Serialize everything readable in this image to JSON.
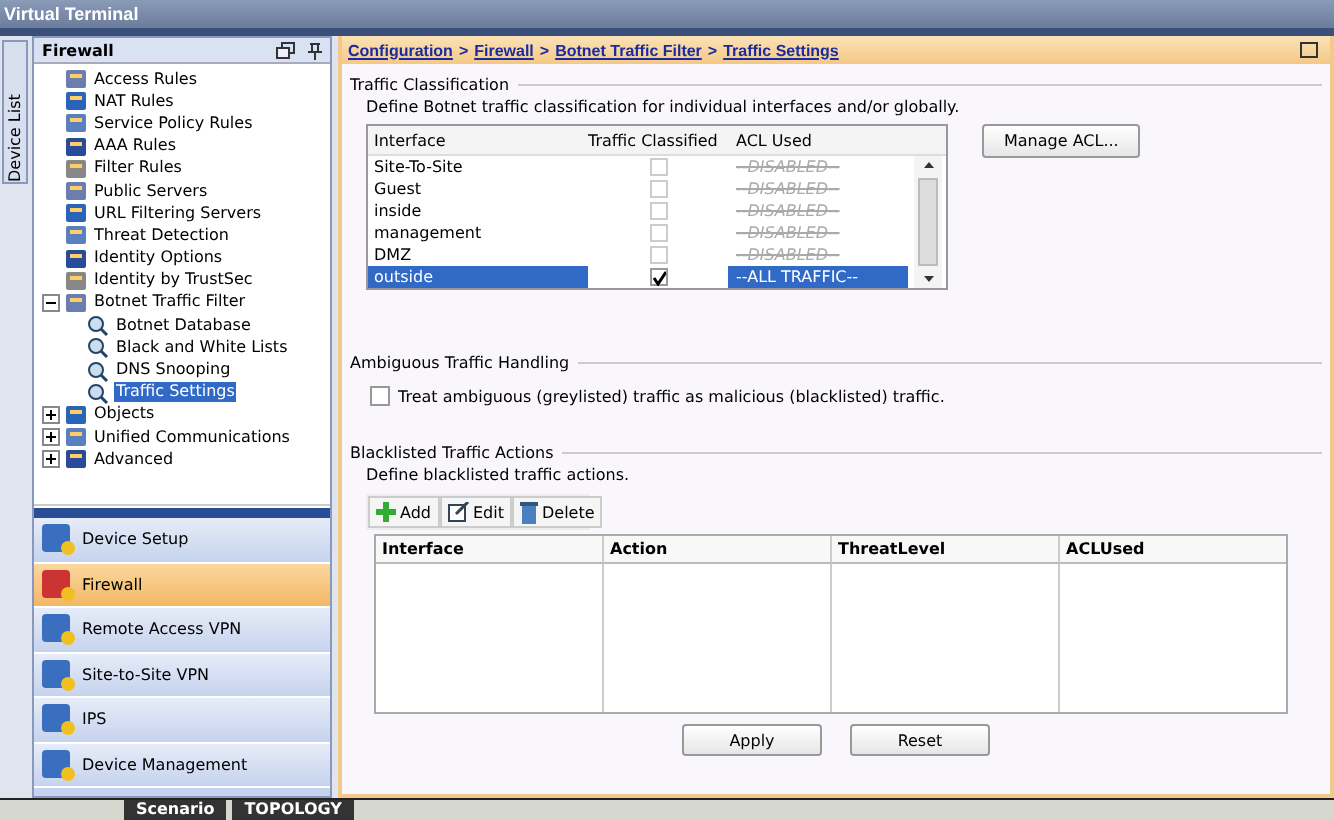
{
  "window": {
    "title": "Virtual Terminal"
  },
  "device_list_tab": {
    "label": "Device List"
  },
  "sidebar": {
    "title": "Firewall",
    "tree": [
      {
        "label": "Access Rules",
        "selected": false
      },
      {
        "label": "NAT Rules",
        "selected": false
      },
      {
        "label": "Service Policy Rules",
        "selected": false
      },
      {
        "label": "AAA Rules",
        "selected": false
      },
      {
        "label": "Filter Rules",
        "selected": false
      },
      {
        "label": "Public Servers",
        "selected": false
      },
      {
        "label": "URL Filtering Servers",
        "selected": false
      },
      {
        "label": "Threat Detection",
        "selected": false
      },
      {
        "label": "Identity Options",
        "selected": false
      },
      {
        "label": "Identity by TrustSec",
        "selected": false
      },
      {
        "label": "Botnet Traffic Filter",
        "selected": false,
        "expanded": true,
        "children": [
          {
            "label": "Botnet Database",
            "selected": false
          },
          {
            "label": "Black and White Lists",
            "selected": false
          },
          {
            "label": "DNS Snooping",
            "selected": false
          },
          {
            "label": "Traffic Settings",
            "selected": true
          }
        ]
      },
      {
        "label": "Objects",
        "selected": false,
        "expanded": false
      },
      {
        "label": "Unified Communications",
        "selected": false,
        "expanded": false
      },
      {
        "label": "Advanced",
        "selected": false,
        "expanded": false
      }
    ],
    "nav": [
      {
        "label": "Device Setup",
        "selected": false
      },
      {
        "label": "Firewall",
        "selected": true
      },
      {
        "label": "Remote Access VPN",
        "selected": false
      },
      {
        "label": "Site-to-Site VPN",
        "selected": false
      },
      {
        "label": "IPS",
        "selected": false
      },
      {
        "label": "Device Management",
        "selected": false
      }
    ]
  },
  "breadcrumb": [
    "Configuration",
    "Firewall",
    "Botnet Traffic Filter",
    "Traffic Settings"
  ],
  "breadcrumb_separator": ">",
  "classification": {
    "legend": "Traffic Classification",
    "description": "Define Botnet traffic classification for individual interfaces and/or globally.",
    "columns": [
      "Interface",
      "Traffic Classified",
      "ACL Used"
    ],
    "rows": [
      {
        "interface": "Site-To-Site",
        "classified": false,
        "acl": "--DISABLED--",
        "disabled": true,
        "selected": false
      },
      {
        "interface": "Guest",
        "classified": false,
        "acl": "--DISABLED--",
        "disabled": true,
        "selected": false
      },
      {
        "interface": "inside",
        "classified": false,
        "acl": "--DISABLED--",
        "disabled": true,
        "selected": false
      },
      {
        "interface": "management",
        "classified": false,
        "acl": "--DISABLED--",
        "disabled": true,
        "selected": false
      },
      {
        "interface": "DMZ",
        "classified": false,
        "acl": "--DISABLED--",
        "disabled": true,
        "selected": false
      },
      {
        "interface": "outside",
        "classified": true,
        "acl": "--ALL TRAFFIC--",
        "disabled": false,
        "selected": true
      }
    ],
    "manage_button": "Manage ACL..."
  },
  "ambiguous": {
    "legend": "Ambiguous Traffic Handling",
    "option": {
      "label": "Treat ambiguous (greylisted) traffic as malicious (blacklisted) traffic.",
      "checked": false
    }
  },
  "blacklisted": {
    "legend": "Blacklisted Traffic Actions",
    "description": "Define blacklisted traffic actions.",
    "toolbar": [
      "Add",
      "Edit",
      "Delete"
    ],
    "columns": [
      "Interface",
      "Action",
      "ThreatLevel",
      "ACLUsed"
    ]
  },
  "buttons": [
    "Apply",
    "Reset"
  ],
  "bottom_tabs": [
    "Scenario",
    "TOPOLOGY"
  ]
}
